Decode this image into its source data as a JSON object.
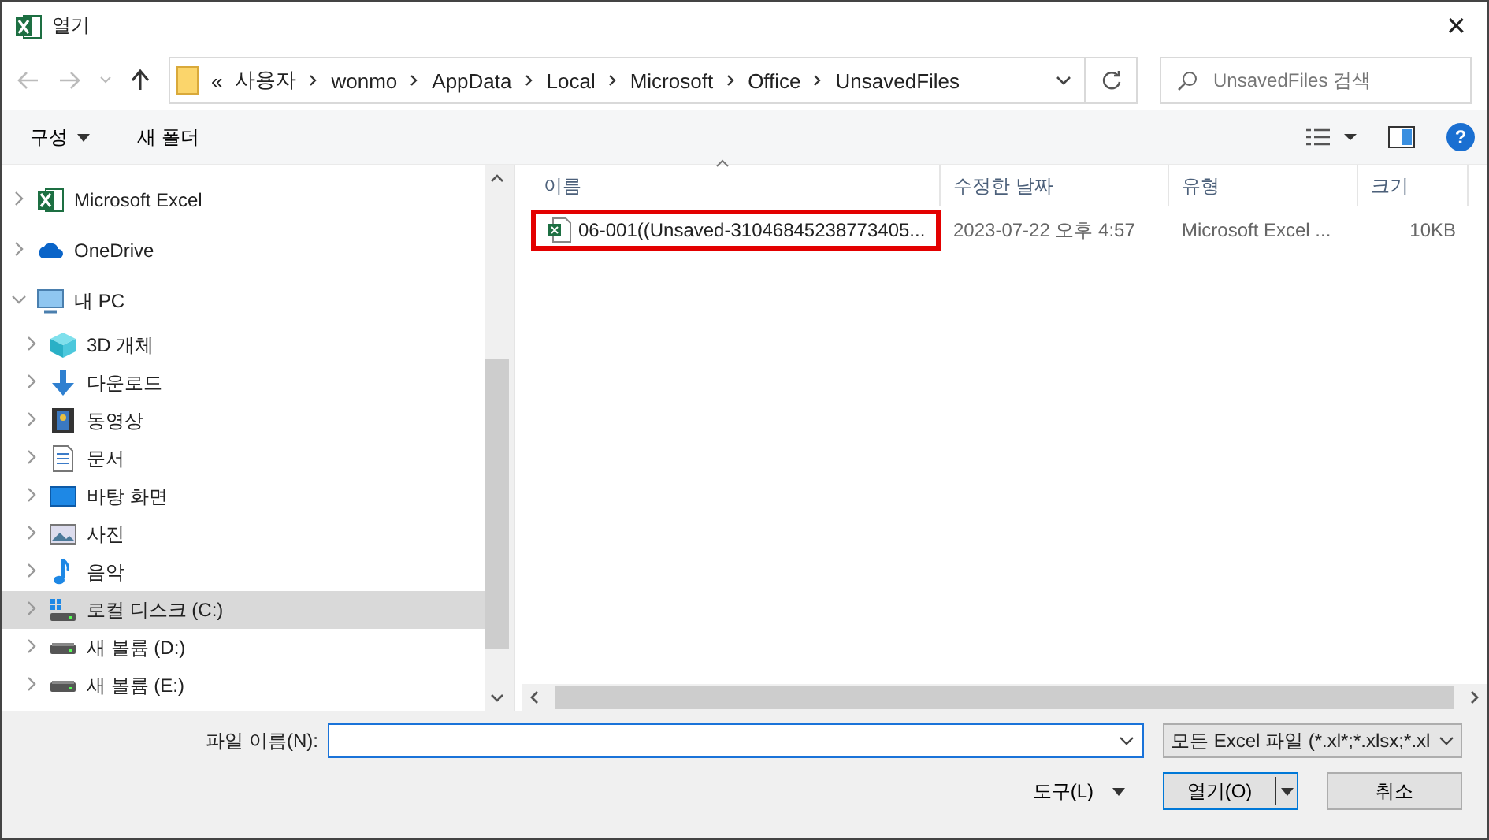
{
  "window": {
    "title": "열기",
    "close": "✕"
  },
  "address": {
    "overflow": "«",
    "segments": [
      "사용자",
      "wonmo",
      "AppData",
      "Local",
      "Microsoft",
      "Office",
      "UnsavedFiles"
    ]
  },
  "search": {
    "placeholder": "UnsavedFiles 검색"
  },
  "toolbar": {
    "organize": "구성",
    "new_folder": "새 폴더",
    "help": "?"
  },
  "sidebar": {
    "items": [
      {
        "label": "Microsoft Excel",
        "kind": "excel",
        "expanded": false,
        "selected": false
      },
      {
        "label": "OneDrive",
        "kind": "cloud",
        "expanded": false,
        "selected": false
      },
      {
        "label": "내 PC",
        "kind": "pc",
        "expanded": true,
        "selected": false,
        "children": [
          {
            "label": "3D 개체",
            "kind": "cube",
            "expanded": false,
            "selected": false
          },
          {
            "label": "다운로드",
            "kind": "download",
            "expanded": false,
            "selected": false
          },
          {
            "label": "동영상",
            "kind": "video",
            "expanded": false,
            "selected": false
          },
          {
            "label": "문서",
            "kind": "document",
            "expanded": false,
            "selected": false
          },
          {
            "label": "바탕 화면",
            "kind": "desktop",
            "expanded": false,
            "selected": false
          },
          {
            "label": "사진",
            "kind": "picture",
            "expanded": false,
            "selected": false
          },
          {
            "label": "음악",
            "kind": "music",
            "expanded": false,
            "selected": false
          },
          {
            "label": "로컬 디스크 (C:)",
            "kind": "system-drive",
            "expanded": false,
            "selected": true
          },
          {
            "label": "새 볼륨 (D:)",
            "kind": "drive",
            "expanded": false,
            "selected": false
          },
          {
            "label": "새 볼륨 (E:)",
            "kind": "drive",
            "expanded": false,
            "selected": false
          }
        ]
      }
    ]
  },
  "table": {
    "columns": [
      {
        "label": "이름",
        "sorted": true
      },
      {
        "label": "수정한 날짜",
        "sorted": false
      },
      {
        "label": "유형",
        "sorted": false
      },
      {
        "label": "크기",
        "sorted": false
      }
    ],
    "rows": [
      {
        "name": "06-001((Unsaved-31046845238773405...",
        "date": "2023-07-22 오후 4:57",
        "type": "Microsoft Excel ...",
        "size": "10KB",
        "highlighted": true
      }
    ]
  },
  "footer": {
    "filename_label": "파일 이름(N):",
    "filter": "모든 Excel 파일 (*.xl*;*.xlsx;*.xl",
    "tools": "도구(L)",
    "open": "열기(O)",
    "cancel": "취소"
  }
}
